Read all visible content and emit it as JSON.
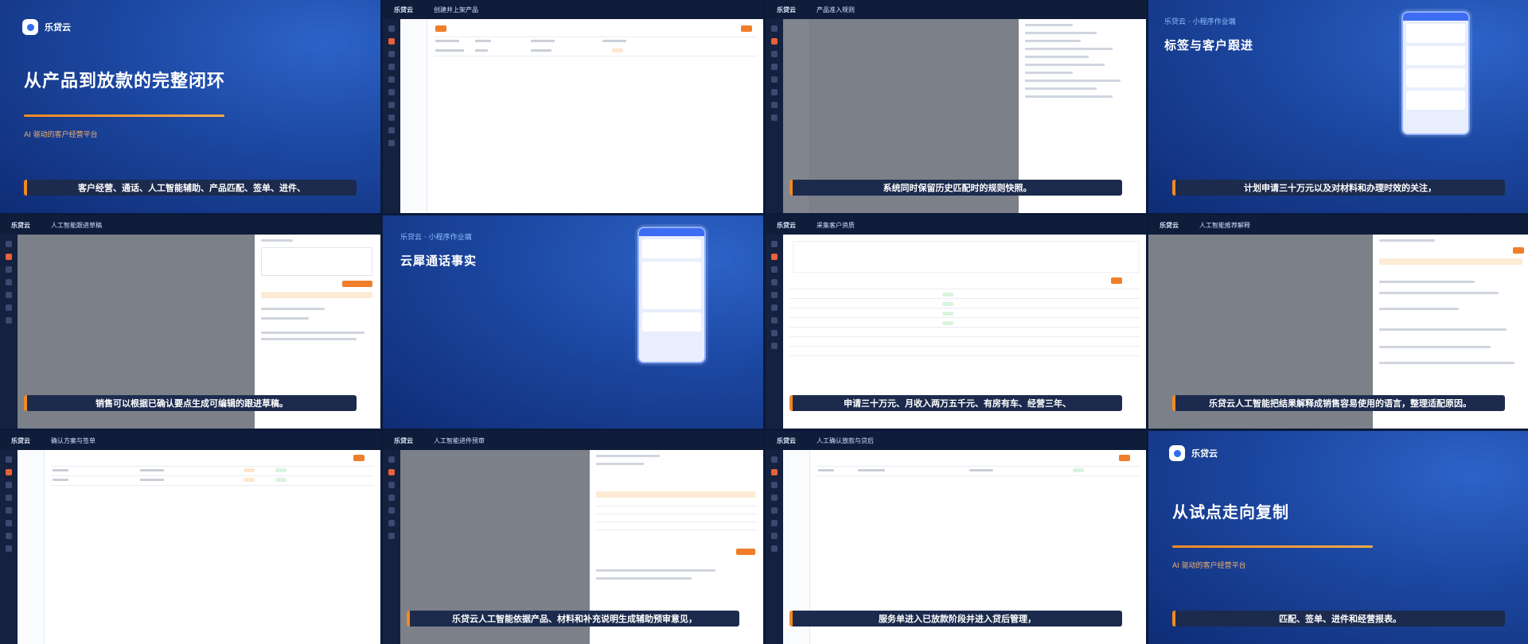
{
  "brand": "乐贷云",
  "tiles": {
    "t1": {
      "title": "从产品到放款的完整闭环",
      "subtitle": "AI 驱动的客户经营平台",
      "caption": "客户经营、通话、人工智能辅助、产品匹配、签单、进件、"
    },
    "t2": {
      "header": "创建并上架产品"
    },
    "t3": {
      "header": "产品准入规则",
      "caption": "系统同时保留历史匹配时的规则快照。"
    },
    "t4": {
      "eyebrow": "乐贷云 · 小程序作业端",
      "title": "标签与客户跟进",
      "caption": "计划申请三十万元以及对材料和办理时效的关注，"
    },
    "t5": {
      "header": "人工智能跟进草稿",
      "caption": "销售可以根据已确认要点生成可编辑的跟进草稿。"
    },
    "t6": {
      "eyebrow": "乐贷云 · 小程序作业端",
      "title": "云犀通话事实"
    },
    "t7": {
      "header": "采集客户资质",
      "caption": "申请三十万元、月收入两万五千元、有房有车、经营三年、"
    },
    "t8": {
      "header": "人工智能推荐解释",
      "caption": "乐贷云人工智能把结果解释成销售容易使用的语言，整理适配原因。"
    },
    "t9": {
      "header": "确认方案与签单"
    },
    "t10": {
      "header": "人工智能进件预审",
      "caption": "乐贷云人工智能依据产品、材料和补充说明生成辅助预审意见，"
    },
    "t11": {
      "header": "人工确认放款与贷后",
      "caption": "服务单进入已放款阶段并进入贷后管理，"
    },
    "t12": {
      "title": "从试点走向复制",
      "subtitle": "AI 驱动的客户经营平台",
      "caption": "匹配、签单、进件和经营报表。"
    }
  },
  "colors": {
    "accent": "#f08a24",
    "brand_blue": "#2f6cf0",
    "topbar": "#0f1d3a"
  }
}
